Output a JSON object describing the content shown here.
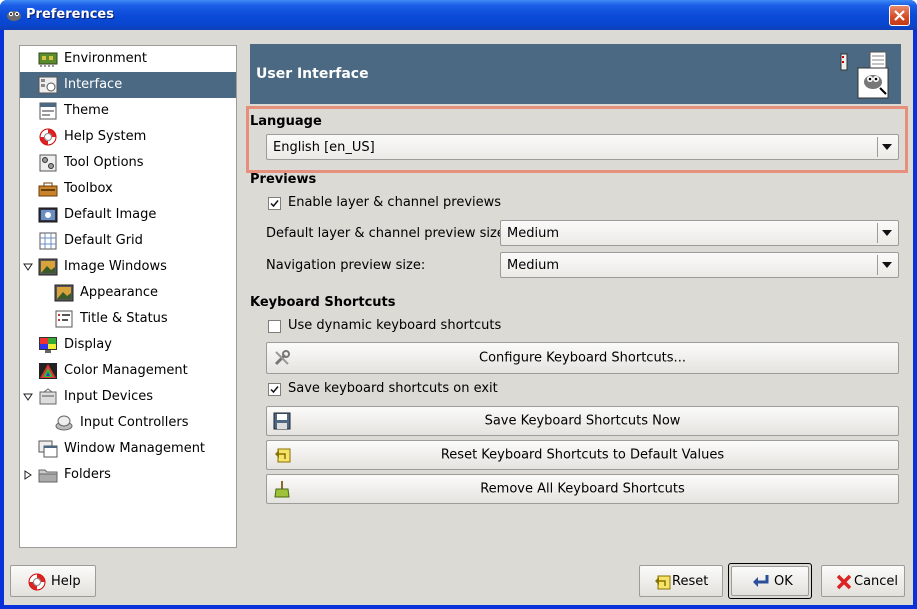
{
  "window": {
    "title": "Preferences"
  },
  "sidebar": {
    "items": [
      {
        "label": "Environment",
        "icon": "environment-icon",
        "selected": false
      },
      {
        "label": "Interface",
        "icon": "interface-icon",
        "selected": true
      },
      {
        "label": "Theme",
        "icon": "theme-icon",
        "selected": false
      },
      {
        "label": "Help System",
        "icon": "help-lifebuoy-icon",
        "selected": false
      },
      {
        "label": "Tool Options",
        "icon": "tool-options-icon",
        "selected": false
      },
      {
        "label": "Toolbox",
        "icon": "toolbox-icon",
        "selected": false
      },
      {
        "label": "Default Image",
        "icon": "default-image-icon",
        "selected": false
      },
      {
        "label": "Default Grid",
        "icon": "default-grid-icon",
        "selected": false
      },
      {
        "label": "Image Windows",
        "icon": "image-windows-icon",
        "selected": false,
        "expanded": true
      },
      {
        "label": "Appearance",
        "icon": "appearance-icon",
        "selected": false
      },
      {
        "label": "Title & Status",
        "icon": "title-status-icon",
        "selected": false
      },
      {
        "label": "Display",
        "icon": "display-icon",
        "selected": false
      },
      {
        "label": "Color Management",
        "icon": "color-management-icon",
        "selected": false
      },
      {
        "label": "Input Devices",
        "icon": "input-devices-icon",
        "selected": false,
        "expanded": true
      },
      {
        "label": "Input Controllers",
        "icon": "input-controllers-icon",
        "selected": false
      },
      {
        "label": "Window Management",
        "icon": "window-management-icon",
        "selected": false
      },
      {
        "label": "Folders",
        "icon": "folders-icon",
        "selected": false,
        "expanded": false
      }
    ]
  },
  "header": {
    "title": "User Interface"
  },
  "language": {
    "section_title": "Language",
    "value": "English [en_US]"
  },
  "previews": {
    "section_title": "Previews",
    "enable_label": "Enable layer & channel previews",
    "enable_checked": true,
    "default_size_label": "Default layer & channel preview size:",
    "default_size_value": "Medium",
    "nav_size_label": "Navigation preview size:",
    "nav_size_value": "Medium"
  },
  "shortcuts": {
    "section_title": "Keyboard Shortcuts",
    "dynamic_label": "Use dynamic keyboard shortcuts",
    "dynamic_checked": false,
    "configure_label": "Configure Keyboard Shortcuts...",
    "save_on_exit_label": "Save keyboard shortcuts on exit",
    "save_on_exit_checked": true,
    "save_now_label": "Save Keyboard Shortcuts Now",
    "reset_label": "Reset Keyboard Shortcuts to Default Values",
    "remove_label": "Remove All Keyboard Shortcuts"
  },
  "footer": {
    "help_label": "Help",
    "reset_label": "Reset",
    "ok_label": "OK",
    "cancel_label": "Cancel"
  },
  "colors": {
    "selection": "#4b6983",
    "titlebar": "#0b4bd8",
    "highlight_border": "#e68f7d",
    "dialog_bg": "#dcdad5"
  }
}
